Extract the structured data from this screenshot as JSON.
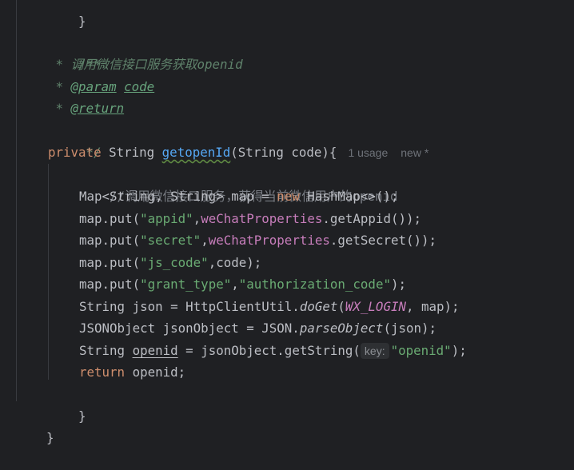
{
  "code": {
    "top_brace": "}",
    "doc_open": "/**",
    "doc_desc_star": " * ",
    "doc_desc": "调用微信接口服务获取openid",
    "doc_param_star": " * ",
    "doc_param_tag": "@param",
    "doc_param_name": "code",
    "doc_return_star": " * ",
    "doc_return_tag": "@return",
    "doc_close": " */",
    "sig_private": "private",
    "sig_type": " String ",
    "sig_method": "getopenId",
    "sig_params": "(String code){",
    "usage_hint": "1 usage",
    "author_hint": "new *",
    "line_comment": "//调用微信接口服务，获得当前微信用户的openid",
    "map_decl": "Map<String, String> map = ",
    "kw_new": "new",
    "map_decl_tail": " HashMap<>();",
    "put_prefix": "map.put(",
    "put1_key": "\"appid\"",
    "put1_field": "weChatProperties",
    "put1_tail": ".getAppid());",
    "put2_key": "\"secret\"",
    "put2_field": "weChatProperties",
    "put2_tail": ".getSecret());",
    "put3_key": "\"js_code\"",
    "put3_tail": ",code);",
    "put4_key": "\"grant_type\"",
    "put4_value": "\"authorization_code\"",
    "put4_tail": ");",
    "json_decl": "String json = HttpClientUtil.",
    "json_method": "doGet",
    "json_const": "WX_LOGIN",
    "json_tail": ", map);",
    "obj_decl": "JSONObject jsonObject = JSON.",
    "obj_method": "parseObject",
    "obj_tail": "(json);",
    "openid_type": "String ",
    "openid_var": "openid",
    "openid_mid": " = jsonObject.getString(",
    "key_hint": "key:",
    "openid_key": "\"openid\"",
    "openid_tail": ");",
    "kw_return": "return",
    "return_tail": " openid;",
    "method_close": "}",
    "class_close": "}"
  },
  "colors": {
    "background": "#1f2023",
    "keyword": "#cf8e6d",
    "string": "#6aab73",
    "field": "#c77dbb",
    "method_decl": "#56a8f5",
    "comment": "#7a7e85",
    "doc_comment": "#5f826b"
  }
}
